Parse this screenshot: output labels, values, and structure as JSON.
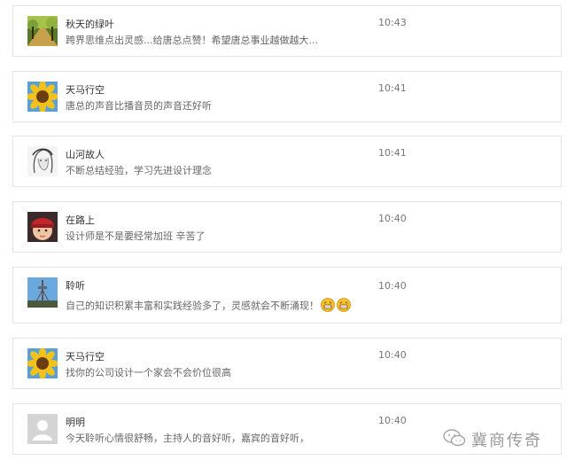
{
  "comments": [
    {
      "name": "秋天的绿叶",
      "time": "10:43",
      "text": "跨界思维点出灵感...给唐总点赞！希望唐总事业越做越大...",
      "avatar": "autumn-road-photo"
    },
    {
      "name": "天马行空",
      "time": "10:41",
      "text": "唐总的声音比播音员的声音还好听",
      "avatar": "sunflower-photo"
    },
    {
      "name": "山河故人",
      "time": "10:41",
      "text": "不断总结经验，学习先进设计理念",
      "avatar": "sketch-portrait"
    },
    {
      "name": "在路上",
      "time": "10:40",
      "text": "设计师是不是要经常加班 辛苦了",
      "avatar": "child-red-hat-photo"
    },
    {
      "name": "聆听",
      "time": "10:40",
      "text": "自己的知识积累丰富和实践经验多了，灵感就会不断涌现！",
      "avatar": "tower-photo",
      "emoji": [
        "grin-emoji",
        "grin-emoji"
      ]
    },
    {
      "name": "天马行空",
      "time": "10:40",
      "text": "找你的公司设计一个家会不会价位很高",
      "avatar": "sunflower-photo"
    },
    {
      "name": "明明",
      "time": "10:40",
      "text": "今天聆听心情很舒畅，主持人的音好听，嘉宾的音好听，",
      "avatar": "default-user-icon"
    }
  ],
  "watermark": {
    "text": "冀商传奇",
    "icon": "wechat-icon"
  },
  "colors": {
    "border": "#e3e3e3",
    "name": "#333333",
    "message": "#666666",
    "time": "#777777"
  }
}
